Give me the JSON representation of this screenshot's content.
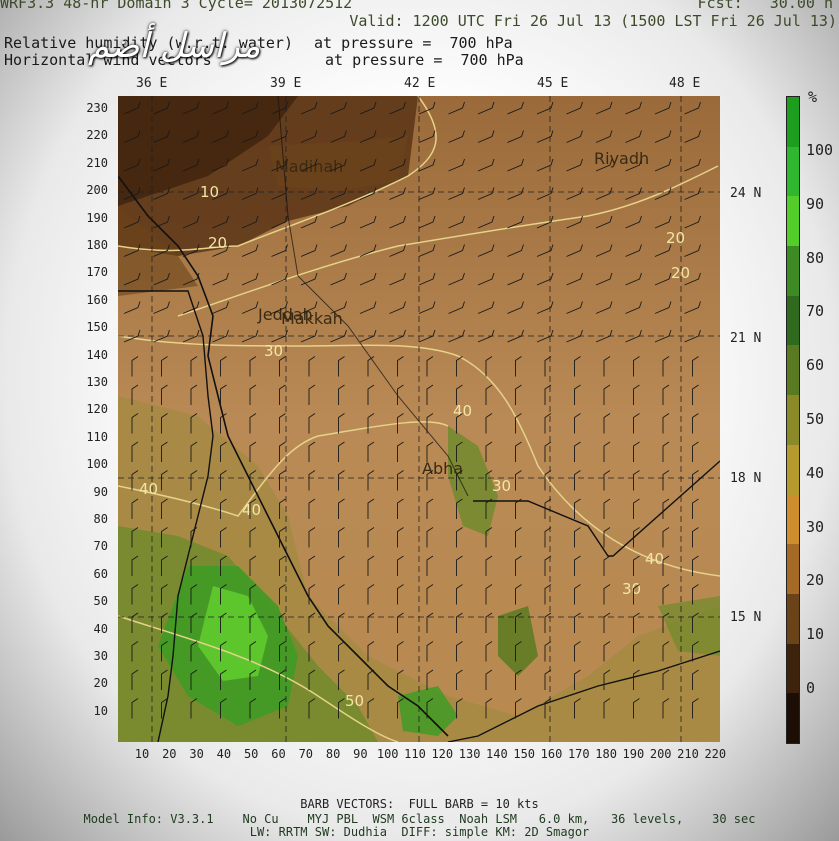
{
  "header": {
    "model_line": "WRF3.3 48-hr Domain 3 Cycle= 2013072512",
    "fcst": "Fcst:   30.00 h",
    "valid": "Valid: 1200 UTC Fri 26 Jul 13 (1500 LST Fri 26 Jul 13)",
    "field1": "Relative humidity (w.r.t. water)",
    "field1_level": "at pressure =  700 hPa",
    "field2": "Horizontal wind vectors",
    "field2_level": "at pressure =  700 hPa"
  },
  "watermark": "مراسل أضم",
  "lon_labels": [
    "36 E",
    "39 E",
    "42 E",
    "45 E",
    "48 E"
  ],
  "lat_labels": [
    "24 N",
    "21 N",
    "18 N",
    "15 N"
  ],
  "grid_y_ticks": [
    "230",
    "220",
    "210",
    "200",
    "190",
    "180",
    "170",
    "160",
    "150",
    "140",
    "130",
    "120",
    "110",
    "100",
    "90",
    "80",
    "70",
    "60",
    "50",
    "40",
    "30",
    "20",
    "10"
  ],
  "grid_x_ticks": [
    "10",
    "20",
    "30",
    "40",
    "50",
    "60",
    "70",
    "80",
    "90",
    "100",
    "110",
    "120",
    "130",
    "140",
    "150",
    "160",
    "170",
    "180",
    "190",
    "200",
    "210",
    "220"
  ],
  "cities": [
    "Madinah",
    "Jeddah",
    "Makkah",
    "Abha",
    "Riyadh"
  ],
  "contour_labels": [
    "10",
    "20",
    "20",
    "20",
    "30",
    "30",
    "30",
    "40",
    "40",
    "40",
    "40",
    "50"
  ],
  "colorbar": {
    "unit": "%",
    "labels": [
      "100",
      "90",
      "80",
      "70",
      "60",
      "50",
      "40",
      "30",
      "20",
      "10",
      "0"
    ],
    "colors": [
      "#1e9e1e",
      "#2fb82f",
      "#52cd2a",
      "#3e8a25",
      "#2f6a1f",
      "#5a7a22",
      "#8a8a28",
      "#b59a2e",
      "#cf8e2e",
      "#a46a26",
      "#6b4319",
      "#3e230c",
      "#1d0e05"
    ]
  },
  "footer": {
    "barb": "BARB VECTORS:  FULL BARB = 10 kts",
    "model_info": "Model Info: V3.3.1    No Cu    MYJ PBL  WSM 6class  Noah LSM   6.0 km,   36 levels,    30 sec",
    "physics": "LW: RRTM SW: Dudhia  DIFF: simple KM: 2D Smagor"
  }
}
